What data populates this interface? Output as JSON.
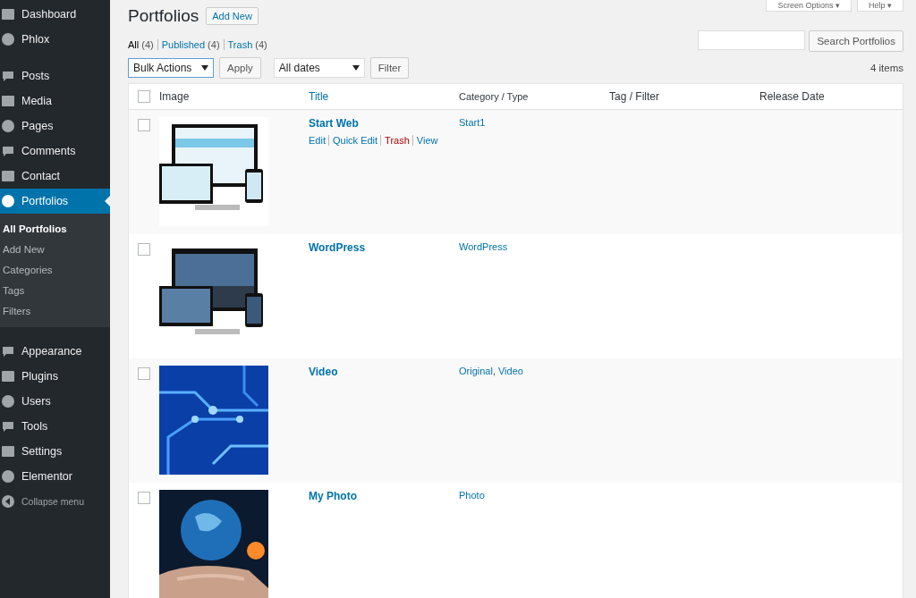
{
  "sidebar": {
    "items": [
      {
        "label": "Dashboard",
        "selected": false
      },
      {
        "label": "Phlox",
        "selected": false
      },
      {
        "label": "Posts",
        "selected": false,
        "separator_before": true
      },
      {
        "label": "Media",
        "selected": false
      },
      {
        "label": "Pages",
        "selected": false
      },
      {
        "label": "Comments",
        "selected": false
      },
      {
        "label": "Contact",
        "selected": false
      },
      {
        "label": "Portfolios",
        "selected": true,
        "children": [
          {
            "label": "All Portfolios",
            "selected": true
          },
          {
            "label": "Add New",
            "selected": false
          },
          {
            "label": "Categories",
            "selected": false
          },
          {
            "label": "Tags",
            "selected": false
          },
          {
            "label": "Filters",
            "selected": false
          }
        ]
      },
      {
        "label": "Appearance",
        "selected": false
      },
      {
        "label": "Plugins",
        "selected": false
      },
      {
        "label": "Users",
        "selected": false
      },
      {
        "label": "Tools",
        "selected": false
      },
      {
        "label": "Settings",
        "selected": false
      },
      {
        "label": "Elementor",
        "selected": false
      },
      {
        "label": "Collapse menu",
        "selected": false,
        "kind": "collapse"
      }
    ]
  },
  "top_buttons": [
    "Screen Options ▾",
    "Help ▾"
  ],
  "page_title": "Portfolios",
  "add_new": "Add New",
  "views": [
    {
      "label": "All",
      "count": "(4)",
      "selected": true
    },
    {
      "label": "Published",
      "count": "(4)",
      "selected": false
    },
    {
      "label": "Trash",
      "count": "(4)",
      "selected": false
    }
  ],
  "search": {
    "button": "Search Portfolios"
  },
  "bulk_actions": {
    "value": "Bulk Actions",
    "button": "Apply"
  },
  "date_filter": {
    "value": "All dates",
    "button": "Filter"
  },
  "item_count": "4 items",
  "table": {
    "all_checked": false,
    "columns": [
      "Image",
      "Title",
      "Category / Type",
      "Tag / Filter",
      "Release Date"
    ],
    "rows": [
      {
        "title": "Start Web",
        "categories": [
          {
            "label": "Start1"
          }
        ],
        "checked": false,
        "image": {
          "kind": "picture"
        },
        "actions": [
          {
            "label": "Edit",
            "kind": "link"
          },
          {
            "label": "Quick Edit",
            "kind": "link"
          },
          {
            "label": "Trash",
            "kind": "delete"
          },
          {
            "label": "View",
            "kind": "link"
          }
        ]
      },
      {
        "title": "WordPress",
        "categories": [
          {
            "label": "WordPress"
          }
        ],
        "checked": false,
        "image": {
          "kind": "picture"
        }
      },
      {
        "title": "Video",
        "categories": [
          {
            "label": "Original",
            "separator": ","
          },
          {
            "label": "Video"
          }
        ],
        "checked": false,
        "image": {
          "kind": "picture"
        }
      },
      {
        "title": "My Photo",
        "categories": [
          {
            "label": "Photo"
          }
        ],
        "checked": false,
        "image": {
          "kind": "picture"
        }
      }
    ]
  }
}
